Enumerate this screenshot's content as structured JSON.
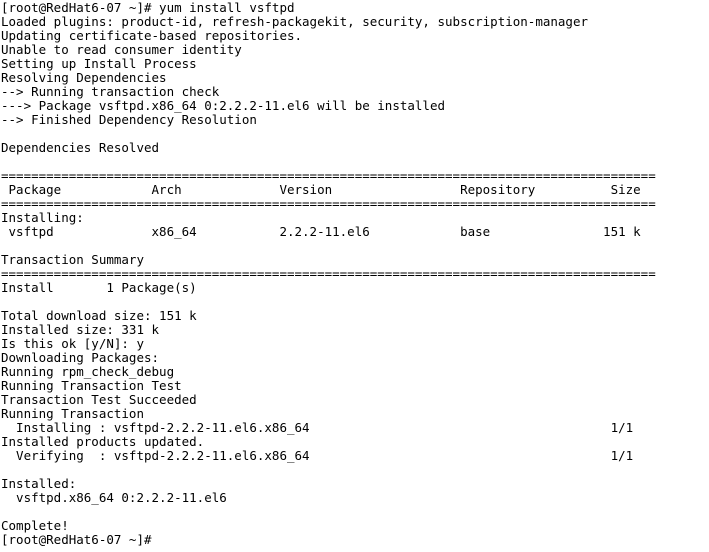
{
  "terminal": {
    "app": "terminal-console",
    "background_color": "#ffffff",
    "foreground_color": "#000000",
    "columns": 87,
    "rows": 39,
    "prompt": "[root@RedHat6-07 ~]#",
    "hostname": "RedHat6-07",
    "user": "root",
    "cwd": "~",
    "command": "yum install vsftpd",
    "lines": [
      "[root@RedHat6-07 ~]# yum install vsftpd",
      "Loaded plugins: product-id, refresh-packagekit, security, subscription-manager",
      "Updating certificate-based repositories.",
      "Unable to read consumer identity",
      "Setting up Install Process",
      "Resolving Dependencies",
      "--> Running transaction check",
      "---> Package vsftpd.x86_64 0:2.2.2-11.el6 will be installed",
      "--> Finished Dependency Resolution",
      "",
      "Dependencies Resolved",
      "",
      "=======================================================================================",
      " Package            Arch             Version                 Repository          Size",
      "=======================================================================================",
      "Installing:",
      " vsftpd             x86_64           2.2.2-11.el6            base               151 k",
      "",
      "Transaction Summary",
      "=======================================================================================",
      "Install       1 Package(s)",
      "",
      "Total download size: 151 k",
      "Installed size: 331 k",
      "Is this ok [y/N]: y",
      "Downloading Packages:",
      "Running rpm_check_debug",
      "Running Transaction Test",
      "Transaction Test Succeeded",
      "Running Transaction",
      "  Installing : vsftpd-2.2.2-11.el6.x86_64                                        1/1 ",
      "Installed products updated.",
      "  Verifying  : vsftpd-2.2.2-11.el6.x86_64                                        1/1 ",
      "",
      "Installed:",
      "  vsftpd.x86_64 0:2.2.2-11.el6",
      "",
      "Complete!",
      "[root@RedHat6-07 ~]#"
    ],
    "details": {
      "plugins": [
        "product-id",
        "refresh-packagekit",
        "security",
        "subscription-manager"
      ],
      "package_name": "vsftpd",
      "package_arch": "x86_64",
      "package_version": "2.2.2-11.el6",
      "package_epoch_version": "0:2.2.2-11.el6",
      "repository": "base",
      "download_size": "151 k",
      "installed_size": "331 k",
      "install_count": "1 Package(s)",
      "confirm_prompt": "Is this ok [y/N]:",
      "confirm_answer": "y",
      "progress_marker": "1/1",
      "final_status": "Complete!",
      "table_headers": [
        "Package",
        "Arch",
        "Version",
        "Repository",
        "Size"
      ],
      "table_row": [
        "vsftpd",
        "x86_64",
        "2.2.2-11.el6",
        "base",
        "151 k"
      ]
    }
  }
}
